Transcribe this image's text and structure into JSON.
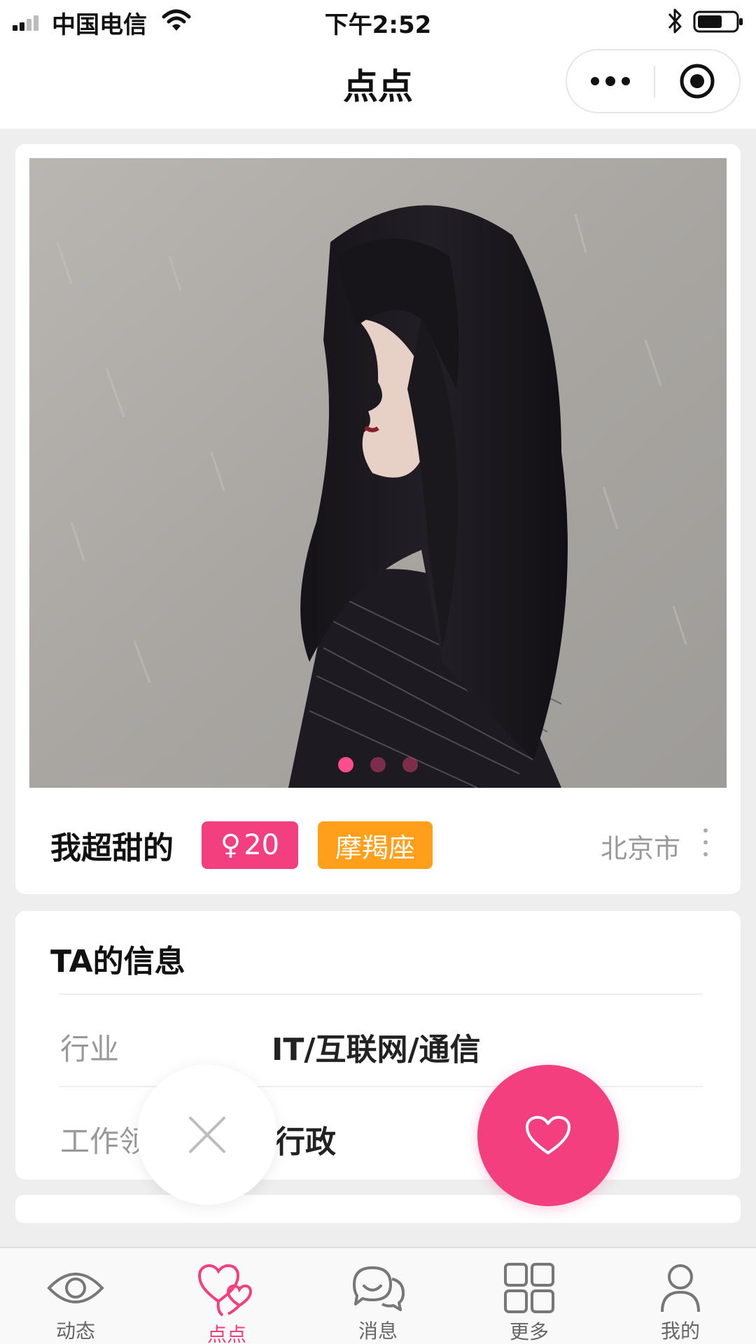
{
  "status_bar": {
    "carrier": "中国电信",
    "time": "下午2:52",
    "icons": [
      "signal-icon",
      "wifi-icon",
      "bluetooth-icon",
      "battery-icon"
    ]
  },
  "nav": {
    "title": "点点",
    "icons": [
      "more-dots-icon",
      "close-target-icon"
    ]
  },
  "profile": {
    "nickname": "我超甜的",
    "gender_symbol": "♀",
    "age": "20",
    "zodiac": "摩羯座",
    "city": "北京市",
    "photo_count": 3,
    "active_photo_index": 0
  },
  "info": {
    "title": "TA的信息",
    "rows": [
      {
        "label": "行业",
        "value": "IT/互联网/通信"
      },
      {
        "label": "工作领域",
        "value": "行政"
      }
    ]
  },
  "actions": {
    "dislike_icon": "close-x-icon",
    "like_icon": "heart-icon"
  },
  "tabs": [
    {
      "label": "动态",
      "icon": "eye-icon",
      "active": false
    },
    {
      "label": "点点",
      "icon": "hearts-icon",
      "active": true
    },
    {
      "label": "消息",
      "icon": "chat-icon",
      "active": false
    },
    {
      "label": "更多",
      "icon": "grid-icon",
      "active": false
    },
    {
      "label": "我的",
      "icon": "user-icon",
      "active": false
    }
  ],
  "colors": {
    "accent_pink": "#f43f7f",
    "zodiac_orange": "#ff9f1a",
    "page_bg": "#eeeeee"
  }
}
